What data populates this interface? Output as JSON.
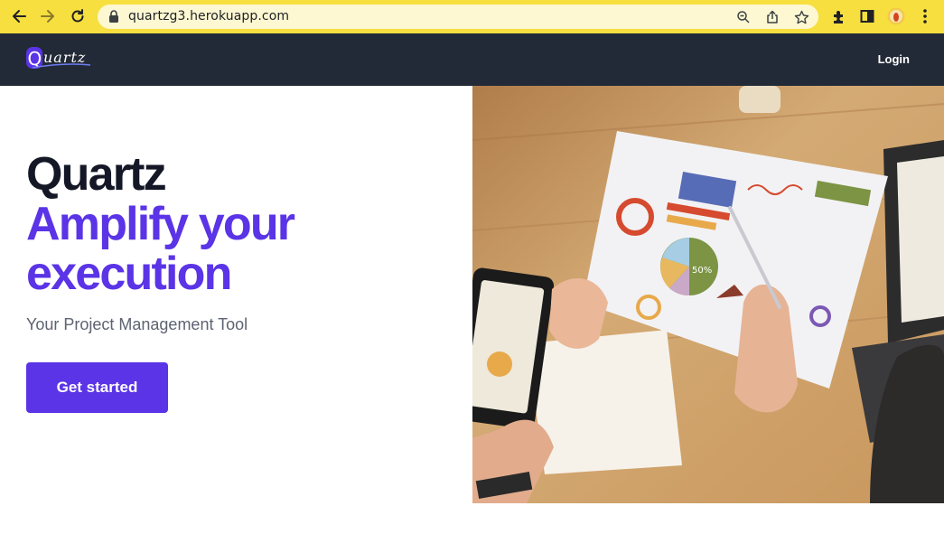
{
  "browser": {
    "url": "quartzg3.herokuapp.com",
    "icons": [
      "back-icon",
      "forward-icon",
      "reload-icon",
      "lock-icon",
      "zoom-icon",
      "share-icon",
      "bookmark-star-icon",
      "extensions-icon",
      "sidepanel-icon",
      "profile-avatar",
      "menu-kebab-icon"
    ]
  },
  "navbar": {
    "logo_text": "Quartz",
    "login_label": "Login",
    "background": "#232a37"
  },
  "hero": {
    "title": "Quartz",
    "subtitle_line1": "Amplify your",
    "subtitle_line2": "execution",
    "tagline": "Your Project Management Tool",
    "cta_label": "Get started",
    "accent": "#5a34e6",
    "photo_pie_label": "50%"
  }
}
